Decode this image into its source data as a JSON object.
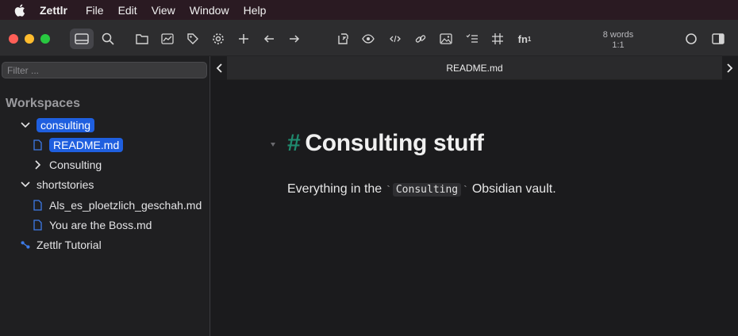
{
  "menubar": {
    "app_name": "Zettlr",
    "items": [
      "File",
      "Edit",
      "View",
      "Window",
      "Help"
    ]
  },
  "toolbar": {
    "word_count": "8 words",
    "cursor_position": "1:1",
    "icons": [
      "sidebar-icon",
      "search-icon",
      "folder-icon",
      "graph-icon",
      "tag-icon",
      "gear-icon",
      "plus-icon",
      "arrow-left-icon",
      "arrow-right-icon",
      "export-icon",
      "eye-icon",
      "code-icon",
      "link-icon",
      "image-icon",
      "list-icon",
      "table-icon",
      "footnote-icon",
      "circle-icon",
      "split-pane-icon"
    ],
    "footnote_label": "fn",
    "footnote_sup": "1"
  },
  "sidebar": {
    "filter_placeholder": "Filter ...",
    "section_title": "Workspaces",
    "tree": {
      "consulting": "consulting",
      "readme": "README.md",
      "consulting_sub": "Consulting",
      "shortstories": "shortstories",
      "file1": "Als_es_ploetzlich_geschah.md",
      "file2": "You are the Boss.md",
      "tutorial": "Zettlr Tutorial"
    }
  },
  "editor": {
    "tab_title": "README.md",
    "heading_hash": "#",
    "heading_text": "Consulting stuff",
    "para_before": "Everything in the",
    "tick": "`",
    "code_text": "Consulting",
    "para_after": "Obsidian vault."
  },
  "colors": {
    "accent": "#1f5fdf",
    "heading_hash": "#1f8a6e",
    "traffic_red": "#ff5f57",
    "traffic_yellow": "#febc2e",
    "traffic_green": "#28c840"
  }
}
